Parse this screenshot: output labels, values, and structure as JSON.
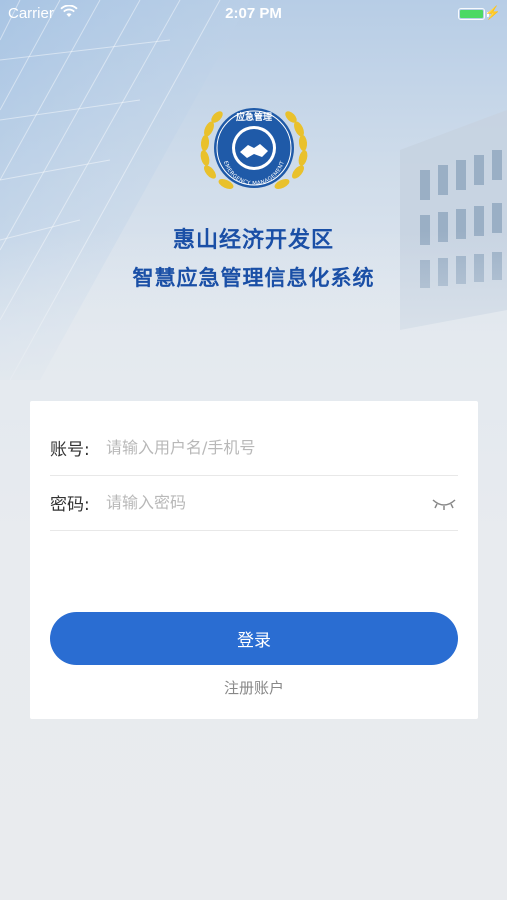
{
  "status_bar": {
    "carrier": "Carrier",
    "time": "2:07 PM",
    "battery_level": 1.0
  },
  "emblem": {
    "top_text": "应急管理",
    "ring_text": "EMERGENCY MANAGEMENT"
  },
  "title": {
    "line1": "惠山经济开发区",
    "line2": "智慧应急管理信息化系统"
  },
  "login": {
    "account_label": "账号:",
    "account_placeholder": "请输入用户名/手机号",
    "password_label": "密码:",
    "password_placeholder": "请输入密码",
    "login_button": "登录",
    "register_link": "注册账户"
  },
  "icons": {
    "wifi": "wifi-icon",
    "battery": "battery-icon",
    "charging": "charging-bolt-icon",
    "password_toggle": "eye-closed-icon"
  },
  "colors": {
    "primary": "#2a6dd2",
    "title": "#1a4fa6",
    "emblem_gold": "#e9c12c",
    "battery": "#4cd964"
  }
}
